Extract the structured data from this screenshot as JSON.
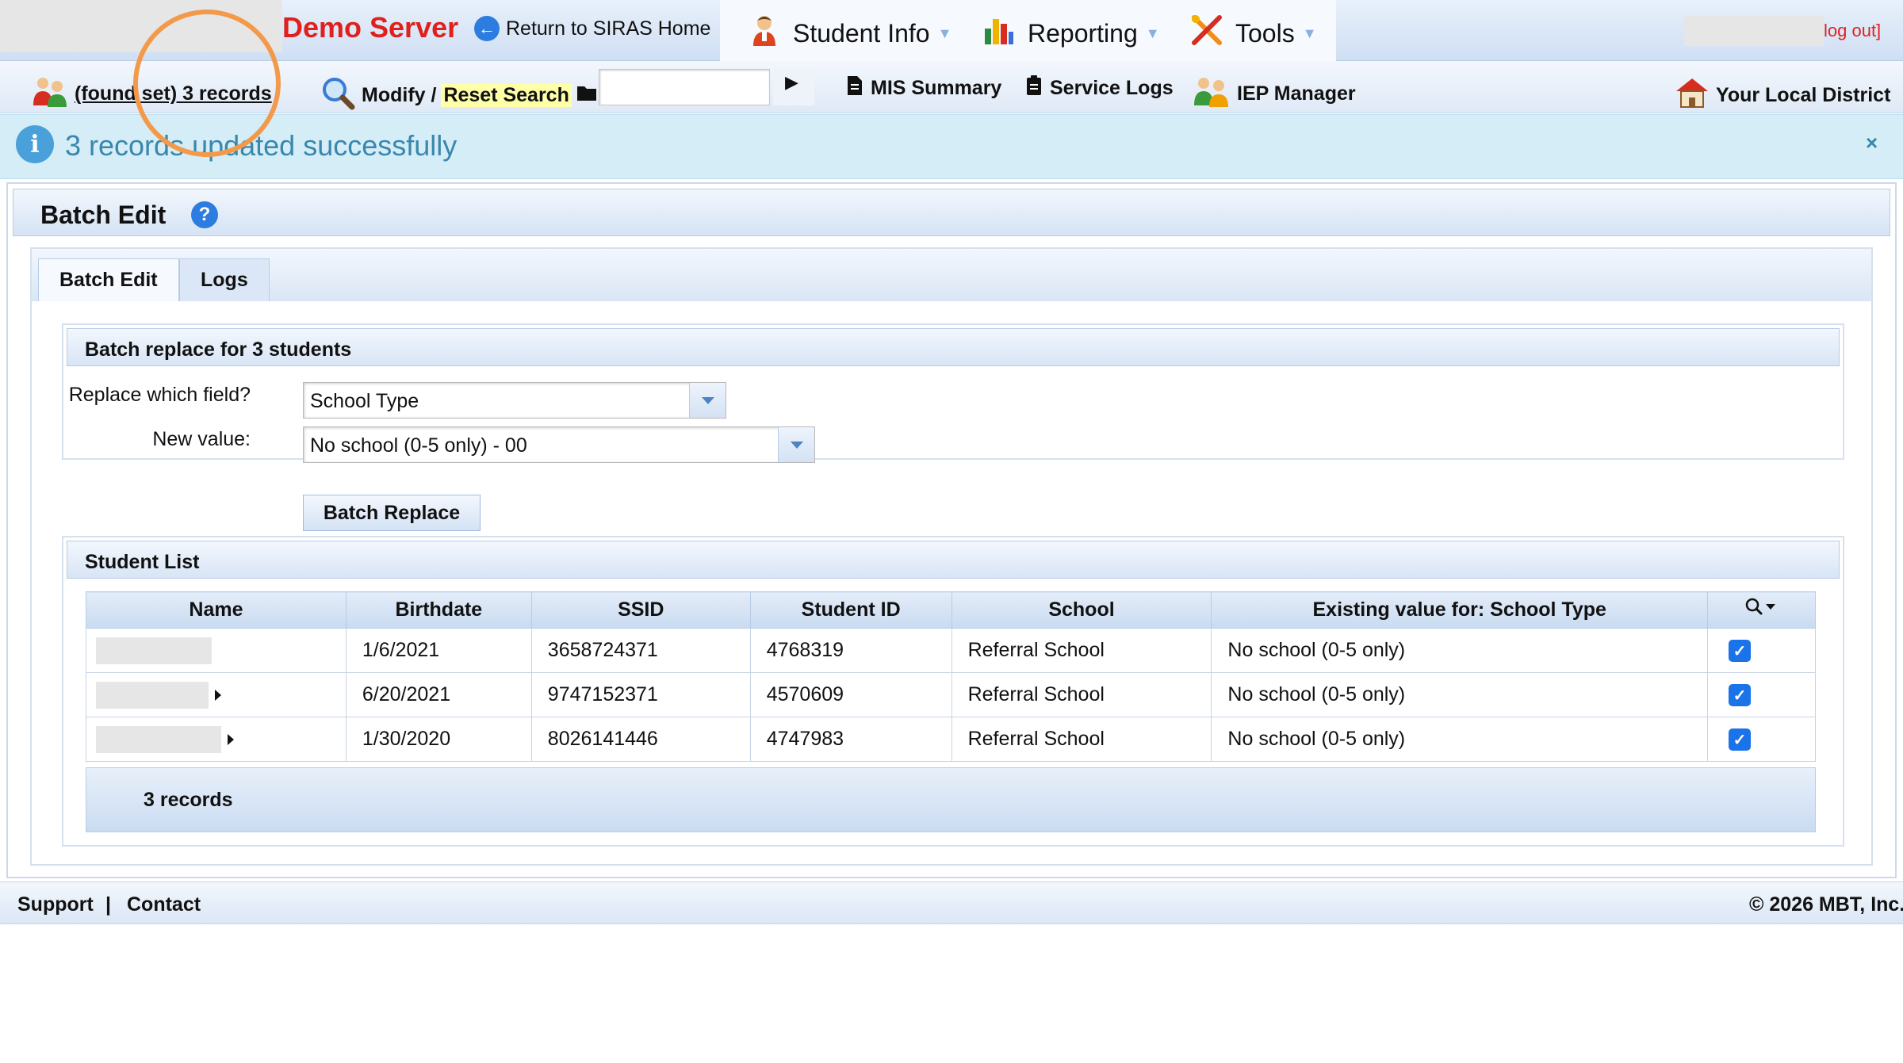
{
  "header": {
    "server_name": "Demo Server",
    "return_label": "Return to SIRAS Home",
    "menus": [
      {
        "label": "Student Info",
        "icon": "student-icon"
      },
      {
        "label": "Reporting",
        "icon": "reporting-icon"
      },
      {
        "label": "Tools",
        "icon": "tools-icon"
      }
    ],
    "logout_label": "log out]"
  },
  "nav": {
    "found_set_label": "(found set) 3 records",
    "modify_label": "Modify /",
    "reset_search_label": "Reset Search",
    "search_value": "",
    "mis_summary_label": "MIS Summary",
    "service_logs_label": "Service Logs",
    "iep_manager_label": "IEP Manager",
    "district_label": "Your Local District"
  },
  "alert": {
    "message": "3 records updated successfully",
    "close_symbol": "×"
  },
  "panel": {
    "title": "Batch Edit",
    "help_symbol": "?",
    "tabs": [
      {
        "label": "Batch Edit",
        "active": true
      },
      {
        "label": "Logs",
        "active": false
      }
    ]
  },
  "batch": {
    "heading": "Batch replace for 3 students",
    "field_label": "Replace which field?",
    "field_value": "School Type",
    "value_label": "New value:",
    "new_value": "No school (0-5 only) - 00",
    "button_label": "Batch Replace"
  },
  "student_list": {
    "heading": "Student List",
    "columns": [
      "Name",
      "Birthdate",
      "SSID",
      "Student ID",
      "School",
      "Existing value for: School Type"
    ],
    "rows": [
      {
        "birthdate": "1/6/2021",
        "ssid": "3658724371",
        "student_id": "4768319",
        "school": "Referral School",
        "existing": "No school (0-5 only)",
        "checked": true
      },
      {
        "birthdate": "6/20/2021",
        "ssid": "9747152371",
        "student_id": "4570609",
        "school": "Referral School",
        "existing": "No school (0-5 only)",
        "checked": true
      },
      {
        "birthdate": "1/30/2020",
        "ssid": "8026141446",
        "student_id": "4747983",
        "school": "Referral School",
        "existing": "No school (0-5 only)",
        "checked": true
      }
    ],
    "footer_count": "3 records"
  },
  "footer": {
    "support_label": "Support",
    "separator": "|",
    "contact_label": "Contact",
    "copyright": "© 2026 MBT, Inc."
  },
  "colors": {
    "server_name": "#e0201c",
    "alert_text": "#3a87ad",
    "alert_bg": "#d4edf6",
    "checkbox": "#1a73e8",
    "highlight_ring": "#f29a4a"
  }
}
